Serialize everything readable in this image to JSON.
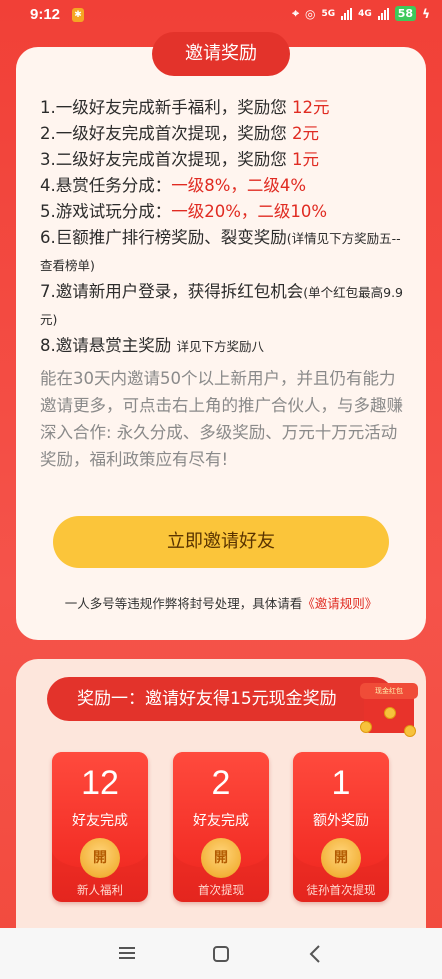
{
  "status_bar": {
    "time": "9:12",
    "net1": "5G",
    "net2": "4G",
    "battery": "58",
    "icons": [
      "location-icon",
      "hotspot-icon",
      "signal-icon",
      "signal-icon",
      "battery-icon",
      "charging-icon"
    ]
  },
  "invite_card": {
    "title": "邀请奖励",
    "rules": [
      {
        "text": "1.一级好友完成新手福利，奖励您 ",
        "highlight": "12元",
        "small": ""
      },
      {
        "text": "2.一级好友完成首次提现，奖励您 ",
        "highlight": "2元",
        "small": ""
      },
      {
        "text": "3.二级好友完成首次提现，奖励您 ",
        "highlight": "1元",
        "small": ""
      },
      {
        "text": "4.悬赏任务分成：",
        "highlight": "一级8%，二级4%",
        "small": ""
      },
      {
        "text": "5.游戏试玩分成：",
        "highlight": "一级20%，二级10%",
        "small": ""
      },
      {
        "text": "6.巨额推广排行榜奖励、裂变奖励",
        "highlight": "",
        "small": "(详情见下方奖励五--查看榜单)"
      },
      {
        "text": "7.邀请新用户登录，获得拆红包机会",
        "highlight": "",
        "small": "(单个红包最高9.9元)"
      },
      {
        "text": "8.邀请悬赏主奖励 ",
        "highlight": "",
        "small": "详见下方奖励八"
      }
    ],
    "description": "能在30天内邀请50个以上新用户，并且仍有能力邀请更多，可点击右上角的推广合伙人，与多趣赚深入合作: 永久分成、多级奖励、万元十万元活动奖励，福利政策应有尽有!",
    "invite_button": "立即邀请好友",
    "notice_text": "一人多号等违规作弊将封号处理，具体请看",
    "notice_link": "《邀请规则》"
  },
  "reward_card": {
    "banner": "奖励一：邀请好友得15元现金奖励",
    "gift_label": "现金红包",
    "envelopes": [
      {
        "amount": "12",
        "label": "好友完成",
        "seal": "開",
        "sub": "新人福利"
      },
      {
        "amount": "2",
        "label": "好友完成",
        "seal": "開",
        "sub": "首次提现"
      },
      {
        "amount": "1",
        "label": "额外奖励",
        "seal": "開",
        "sub": "徒孙首次提现"
      }
    ]
  },
  "colors": {
    "accent_red": "#e3332b",
    "highlight_red": "#e02b22",
    "button_yellow": "#fbc53a"
  }
}
